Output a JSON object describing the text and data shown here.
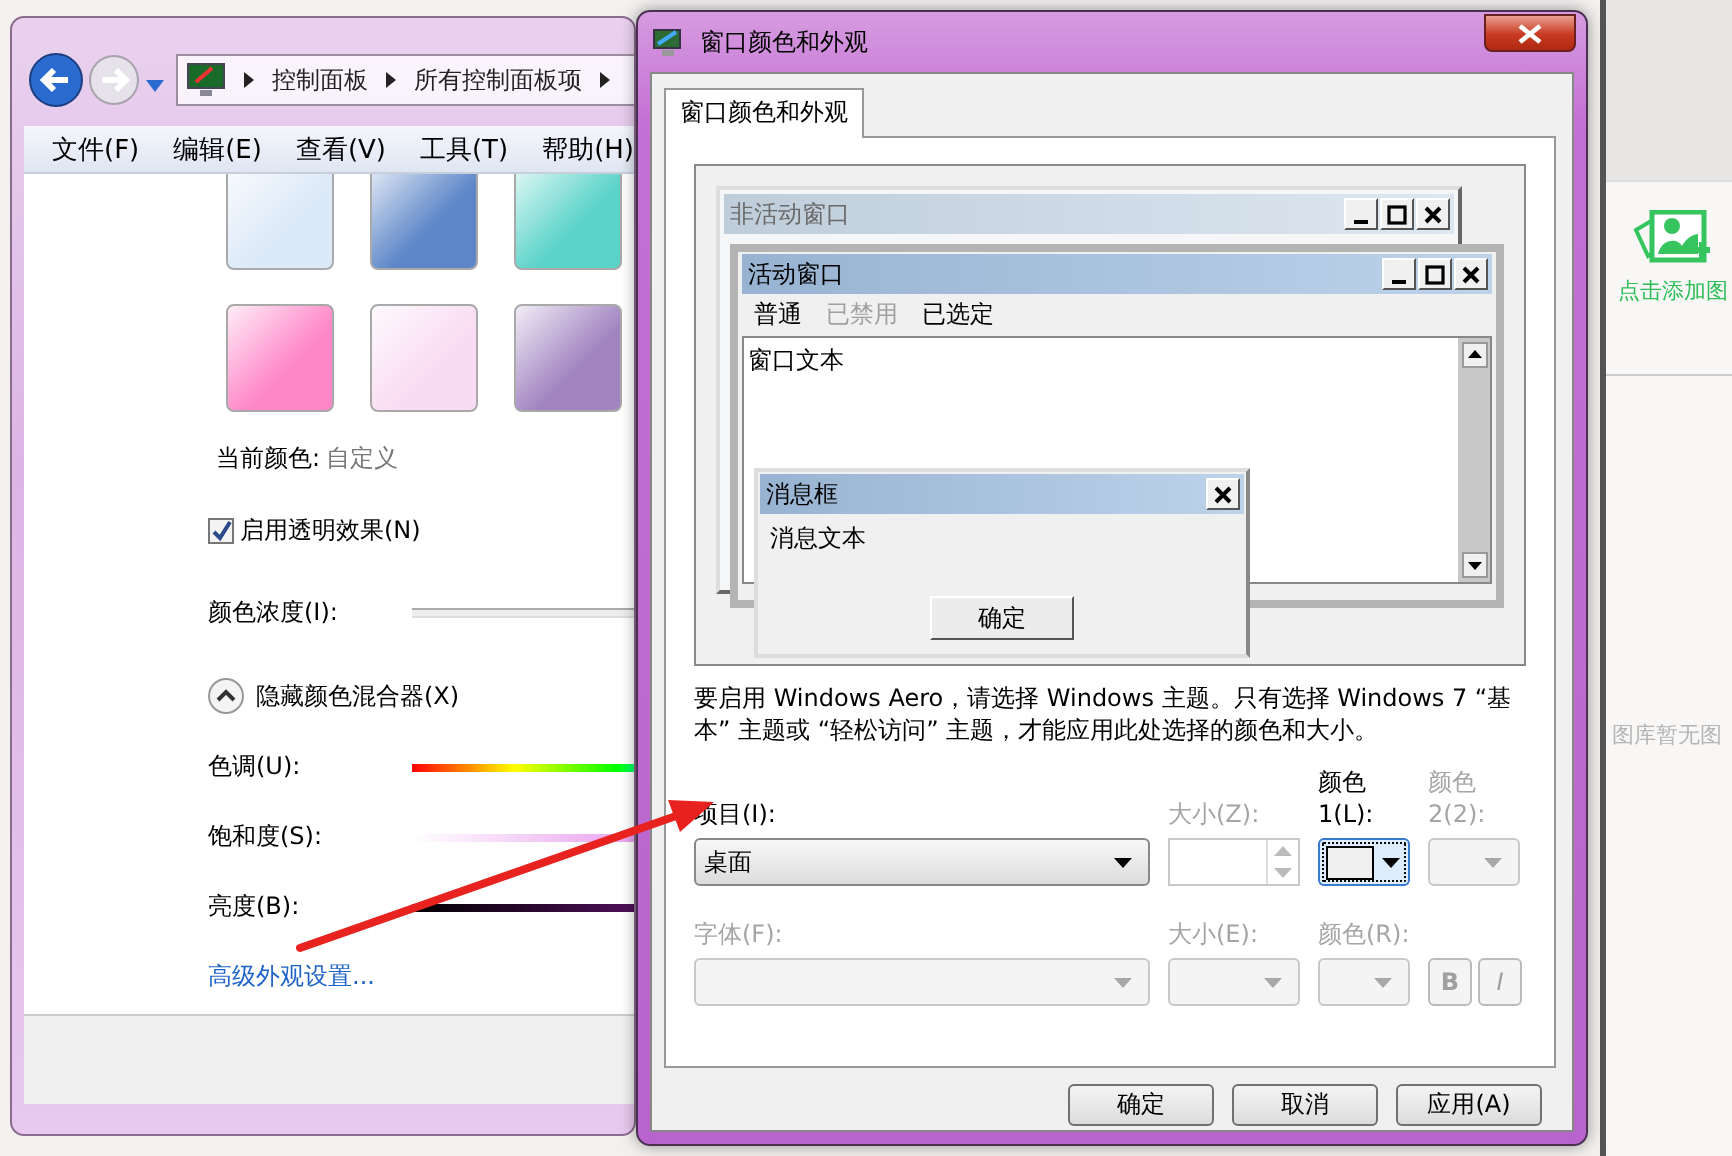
{
  "control_panel": {
    "breadcrumb": [
      "控制面板",
      "所有控制面板项"
    ],
    "menu": [
      "文件(F)",
      "编辑(E)",
      "查看(V)",
      "工具(T)",
      "帮助(H)"
    ],
    "swatches": [
      {
        "color": "#dce9f8"
      },
      {
        "color": "#5c86c8"
      },
      {
        "color": "#5ad3c9"
      },
      {
        "color": "#ff86c8"
      },
      {
        "color": "#f9dcf3"
      },
      {
        "color": "#a184c0"
      }
    ],
    "current_color": {
      "label": "当前颜色:",
      "value": "自定义"
    },
    "transparency": {
      "label": "启用透明效果(N)",
      "checked": true
    },
    "intensity": {
      "label": "颜色浓度(I):"
    },
    "mixer_toggle": {
      "label": "隐藏颜色混合器(X)",
      "expanded": true
    },
    "mixer": [
      {
        "label": "色调(U):",
        "kind": "hue"
      },
      {
        "label": "饱和度(S):",
        "kind": "saturation"
      },
      {
        "label": "亮度(B):",
        "kind": "brightness"
      }
    ],
    "advanced_link": "高级外观设置..."
  },
  "dialog": {
    "title": "窗口颜色和外观",
    "tabs": [
      {
        "label": "窗口颜色和外观",
        "selected": true
      }
    ],
    "preview": {
      "inactive_title": "非活动窗口",
      "active_title": "活动窗口",
      "menu": [
        {
          "label": "普通",
          "disabled": false
        },
        {
          "label": "已禁用",
          "disabled": true
        },
        {
          "label": "已选定",
          "disabled": false
        }
      ],
      "window_text": "窗口文本",
      "message_title": "消息框",
      "message_text": "消息文本",
      "message_button": "确定"
    },
    "description": "要启用 Windows Aero，请选择 Windows 主题。只有选择 Windows 7 “基本” 主题或 “轻松访问” 主题，才能应用此处选择的颜色和大小。",
    "rows": [
      [
        {
          "label": "项目(I):",
          "kind": "select",
          "value": "桌面",
          "disabled": false
        },
        {
          "label": "大小(Z):",
          "kind": "spin",
          "disabled": true
        },
        {
          "label": "颜色1(L):",
          "kind": "color",
          "disabled": false
        },
        {
          "label": "颜色2(2):",
          "kind": "select",
          "disabled": true
        }
      ],
      [
        {
          "label": "字体(F):",
          "kind": "select",
          "disabled": true
        },
        {
          "label": "大小(E):",
          "kind": "select",
          "disabled": true
        },
        {
          "label": "颜色(R):",
          "kind": "select",
          "disabled": true
        },
        {
          "kind": "style",
          "buttons": [
            "B",
            "I"
          ],
          "disabled": true
        }
      ]
    ],
    "buttons": [
      "确定",
      "取消",
      "应用(A)"
    ]
  },
  "side_panel": {
    "add_image": "点击添加图",
    "empty_text": "图库暂无图"
  }
}
